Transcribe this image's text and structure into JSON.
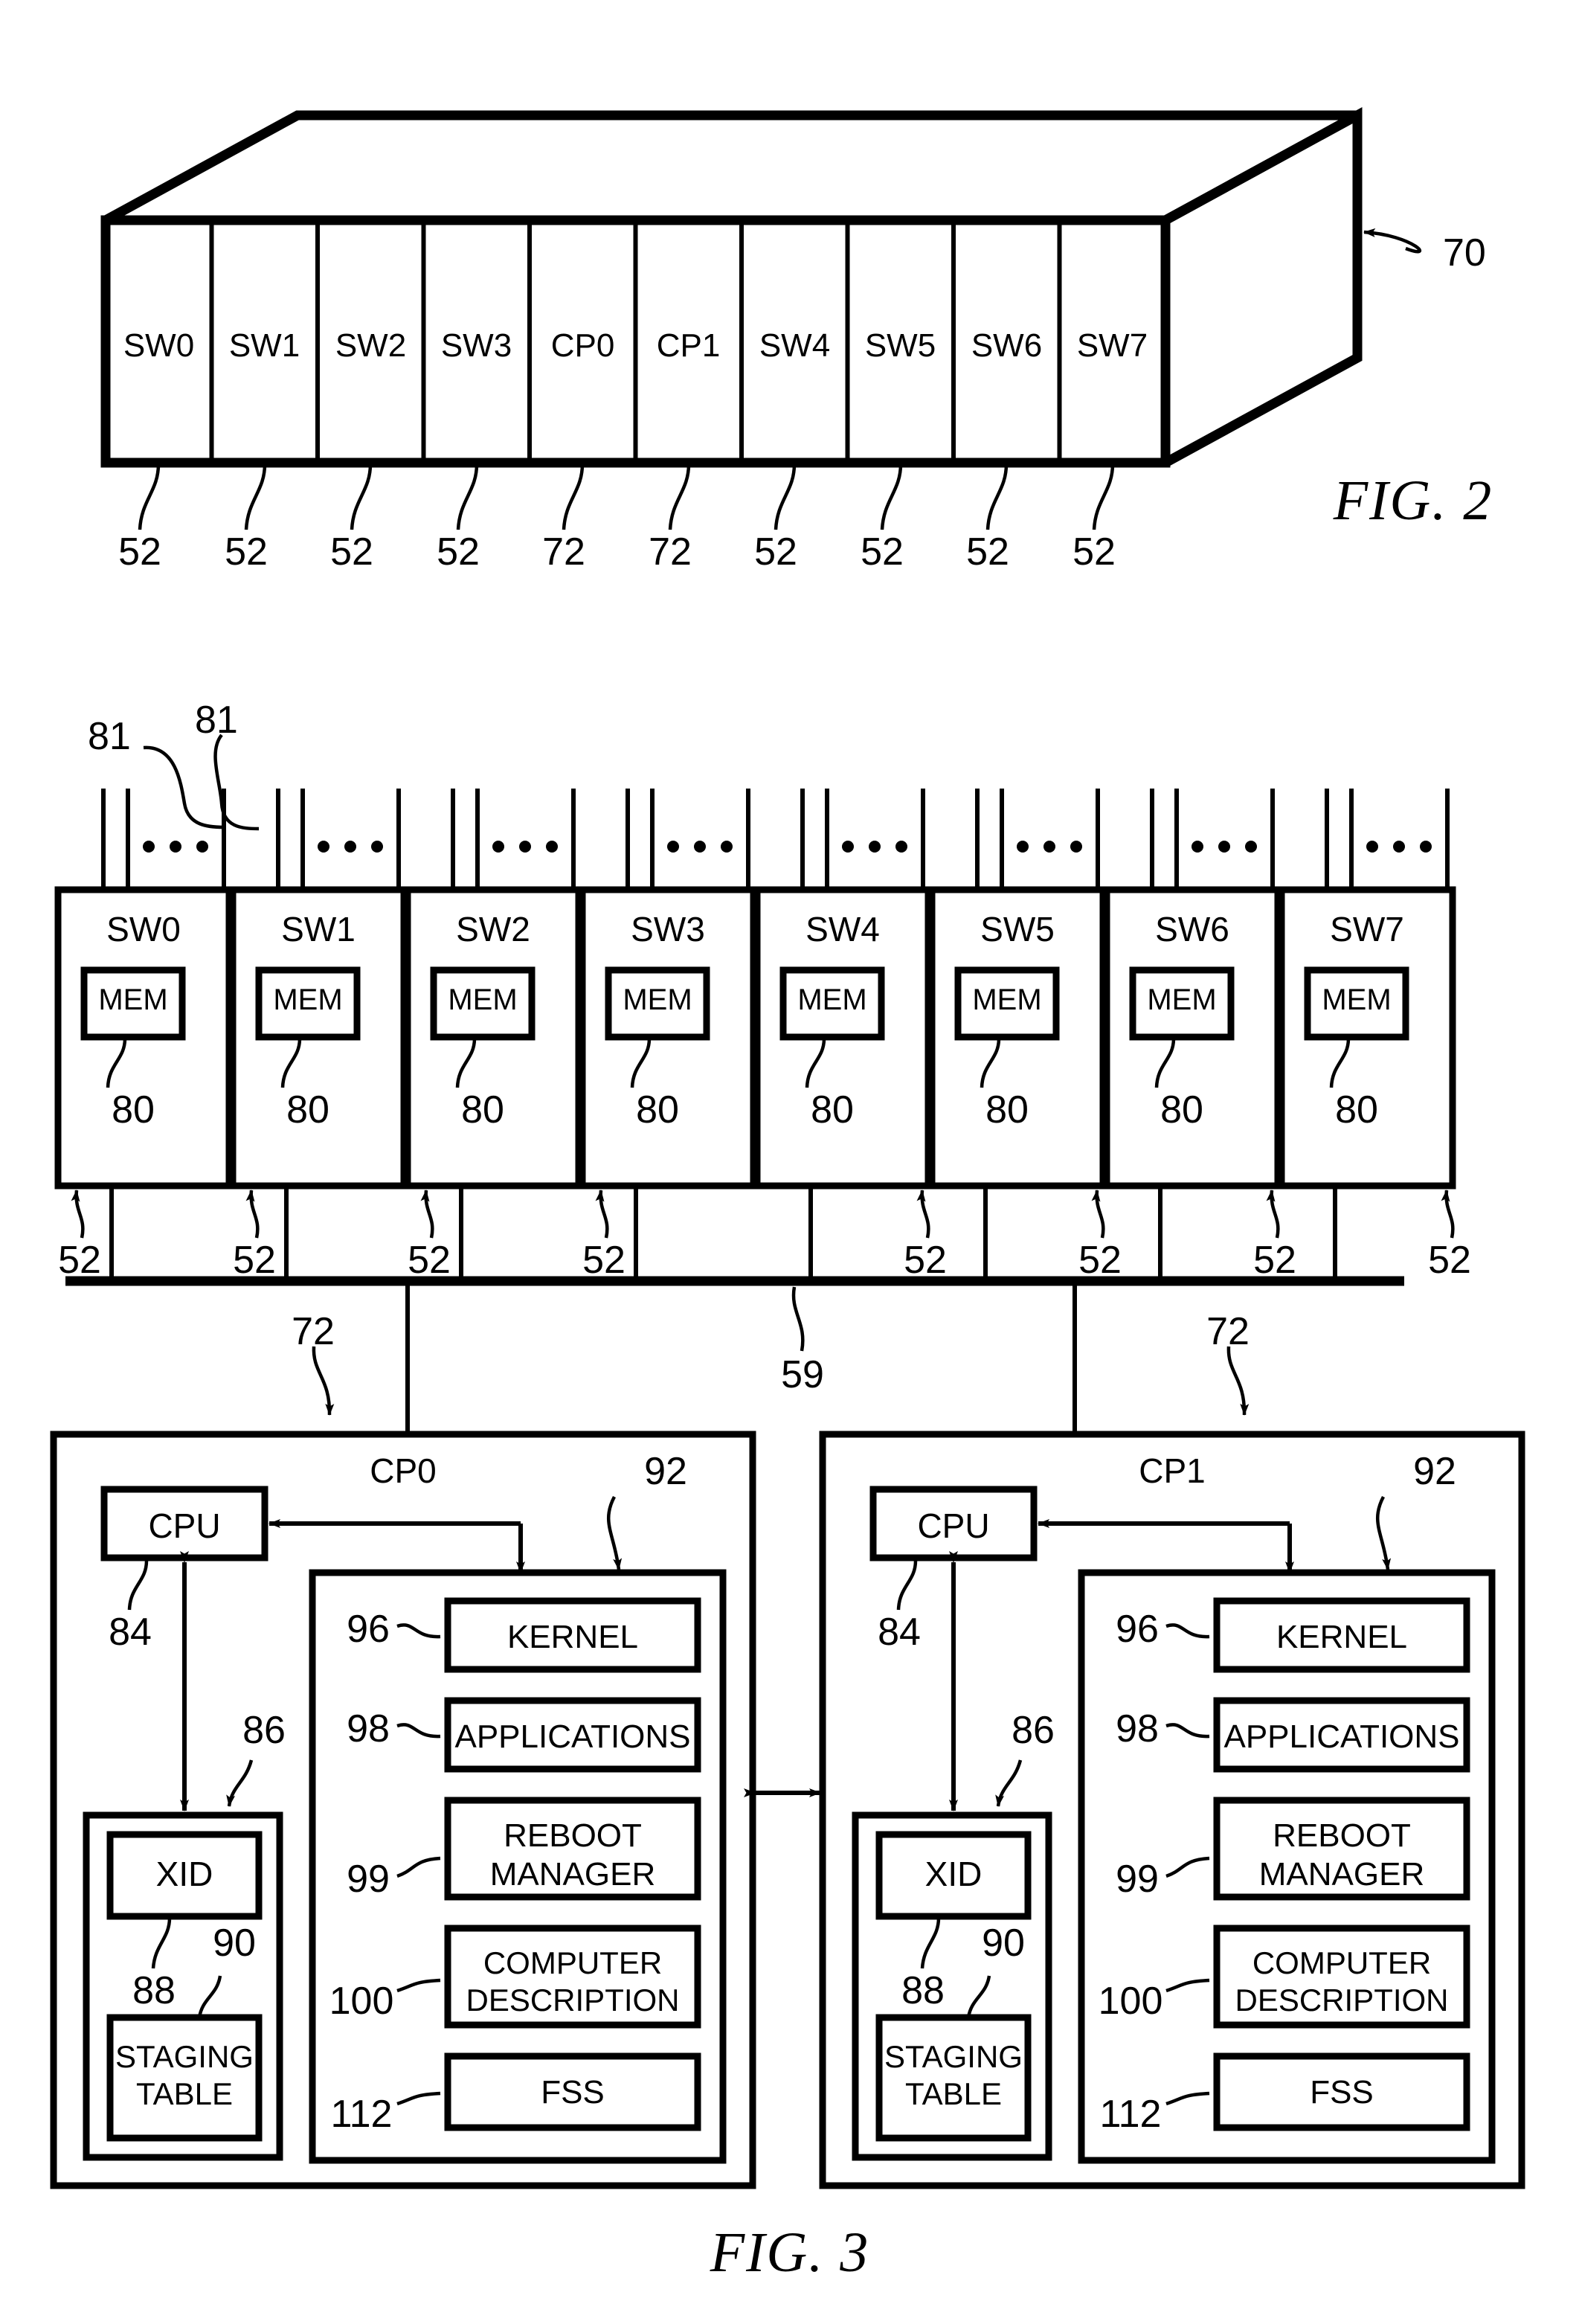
{
  "figures": [
    {
      "caption": "FIG. 2",
      "callout": "70",
      "slots": [
        {
          "label": "SW0",
          "ref": "52"
        },
        {
          "label": "SW1",
          "ref": "52"
        },
        {
          "label": "SW2",
          "ref": "52"
        },
        {
          "label": "SW3",
          "ref": "52"
        },
        {
          "label": "CP0",
          "ref": "72"
        },
        {
          "label": "CP1",
          "ref": "72"
        },
        {
          "label": "SW4",
          "ref": "52"
        },
        {
          "label": "SW5",
          "ref": "52"
        },
        {
          "label": "SW6",
          "ref": "52"
        },
        {
          "label": "SW7",
          "ref": "52"
        }
      ]
    },
    {
      "caption": "FIG. 3",
      "port_refs": [
        "81",
        "81"
      ],
      "bus_ref": "59",
      "switch_link_ref": "52",
      "cp_link_ref": "72",
      "switches": [
        {
          "label": "SW0",
          "memory": "MEM",
          "mem_ref": "80",
          "link_ref": "52"
        },
        {
          "label": "SW1",
          "memory": "MEM",
          "mem_ref": "80",
          "link_ref": "52"
        },
        {
          "label": "SW2",
          "memory": "MEM",
          "mem_ref": "80",
          "link_ref": "52"
        },
        {
          "label": "SW3",
          "memory": "MEM",
          "mem_ref": "80",
          "link_ref": "52"
        },
        {
          "label": "SW4",
          "memory": "MEM",
          "mem_ref": "80",
          "link_ref": "52"
        },
        {
          "label": "SW5",
          "memory": "MEM",
          "mem_ref": "80",
          "link_ref": "52"
        },
        {
          "label": "SW6",
          "memory": "MEM",
          "mem_ref": "80",
          "link_ref": "52"
        },
        {
          "label": "SW7",
          "memory": "MEM",
          "mem_ref": "80",
          "link_ref": "52"
        }
      ],
      "control_processors": [
        {
          "label": "CP0",
          "link_ref": "72",
          "cpu": {
            "label": "CPU",
            "ref": "84"
          },
          "storage": {
            "ref": "86",
            "xid": {
              "label": "XID",
              "ref": "88"
            },
            "staging_table": {
              "label": "STAGING TABLE",
              "ref": "90"
            }
          },
          "firmware": {
            "ref": "92",
            "items": [
              {
                "label": "KERNEL",
                "ref": "96"
              },
              {
                "label": "APPLICATIONS",
                "ref": "98"
              },
              {
                "label": "REBOOT MANAGER",
                "ref": "99"
              },
              {
                "label": "COMPUTER DESCRIPTION",
                "ref": "100"
              },
              {
                "label": "FSS",
                "ref": "112"
              }
            ]
          }
        },
        {
          "label": "CP1",
          "link_ref": "72",
          "cpu": {
            "label": "CPU",
            "ref": "84"
          },
          "storage": {
            "ref": "86",
            "xid": {
              "label": "XID",
              "ref": "88"
            },
            "staging_table": {
              "label": "STAGING TABLE",
              "ref": "90"
            }
          },
          "firmware": {
            "ref": "92",
            "items": [
              {
                "label": "KERNEL",
                "ref": "96"
              },
              {
                "label": "APPLICATIONS",
                "ref": "98"
              },
              {
                "label": "REBOOT MANAGER",
                "ref": "99"
              },
              {
                "label": "COMPUTER DESCRIPTION",
                "ref": "100"
              },
              {
                "label": "FSS",
                "ref": "112"
              }
            ]
          }
        }
      ]
    }
  ]
}
